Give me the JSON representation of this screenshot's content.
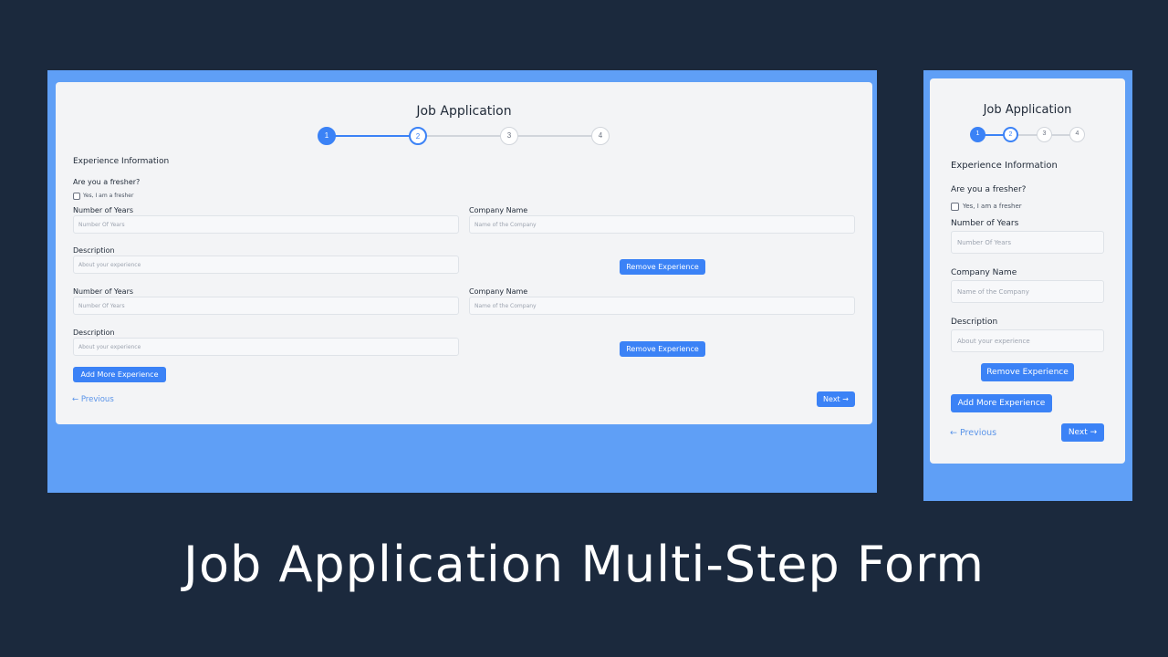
{
  "caption": "Job Application Multi-Step Form",
  "colors": {
    "background": "#1b293d",
    "frame": "#5f9ff6",
    "card": "#f3f4f6",
    "accent": "#3b82f6"
  },
  "form": {
    "title": "Job Application",
    "steps": [
      "1",
      "2",
      "3",
      "4"
    ],
    "current_step": 2,
    "section_title": "Experience Information",
    "fresher_question": "Are you a fresher?",
    "fresher_checkbox_label": "Yes, I am a fresher",
    "years_label": "Number of Years",
    "years_placeholder": "Number Of Years",
    "company_label": "Company Name",
    "company_placeholder": "Name of the Company",
    "description_label": "Description",
    "description_placeholder": "About your experience",
    "remove_button": "Remove Experience",
    "add_button": "Add More Experience",
    "previous_link": "← Previous",
    "next_button": "Next →"
  }
}
